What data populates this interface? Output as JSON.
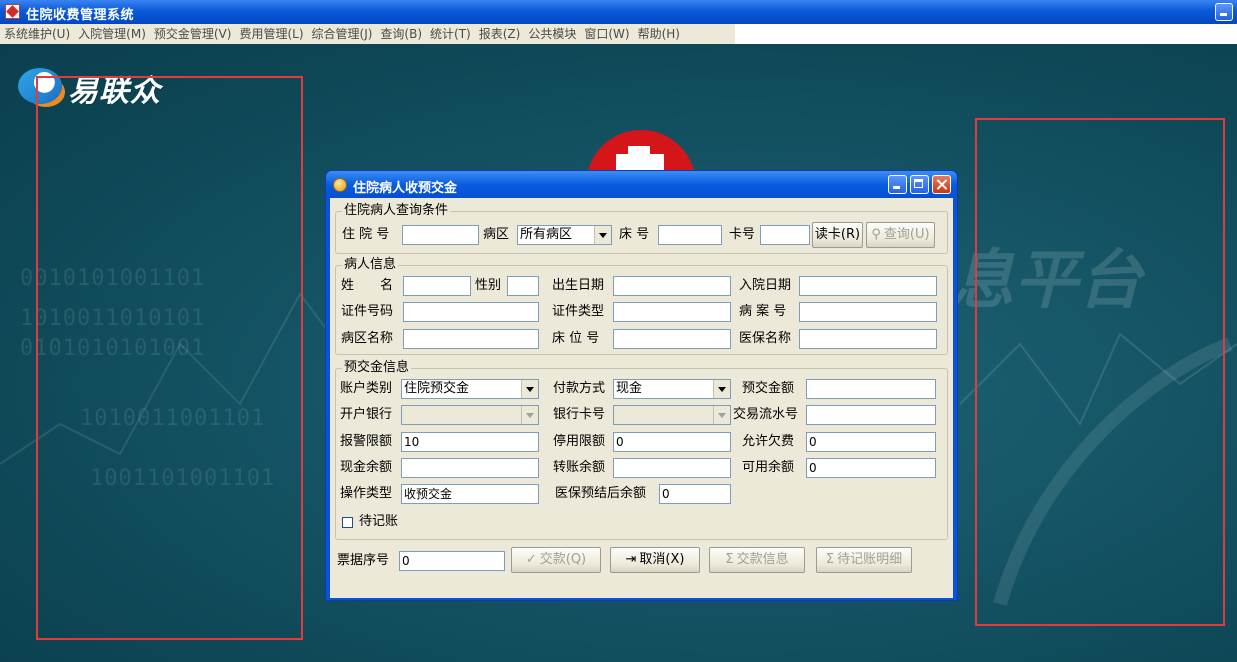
{
  "app": {
    "title": "住院收费管理系统"
  },
  "menu": [
    "系统维护(U)",
    "入院管理(M)",
    "预交金管理(V)",
    "费用管理(L)",
    "综合管理(J)",
    "查询(B)",
    "统计(T)",
    "报表(Z)",
    "公共模块",
    "窗口(W)",
    "帮助(H)"
  ],
  "desktop": {
    "logo_text": "易联众",
    "binary_rows": [
      "0010101001101",
      "1010011010101",
      "0101010101001",
      "1010011001101",
      "1001101001101"
    ],
    "platform_text": "息平台"
  },
  "dialog": {
    "title": "住院病人收预交金",
    "query_group": {
      "legend": "住院病人查询条件",
      "hospital_no_label": "住 院 号",
      "hospital_no_value": "",
      "ward_label": "病区",
      "ward_value": "所有病区",
      "bed_label": "床 号",
      "bed_value": "",
      "card_label": "卡号",
      "card_value": "",
      "read_card_button": "读卡(R)",
      "query_button": "查询(U)"
    },
    "patient_group": {
      "legend": "病人信息",
      "name_label": "姓　　名",
      "name_value": "",
      "gender_label": "性别",
      "gender_value": "",
      "birth_label": "出生日期",
      "birth_value": "",
      "admit_label": "入院日期",
      "admit_value": "",
      "id_no_label": "证件号码",
      "id_no_value": "",
      "id_type_label": "证件类型",
      "id_type_value": "",
      "case_no_label": "病 案 号",
      "case_no_value": "",
      "ward_name_label": "病区名称",
      "ward_name_value": "",
      "bed_no_label": "床 位 号",
      "bed_no_value": "",
      "insurance_label": "医保名称",
      "insurance_value": ""
    },
    "deposit_group": {
      "legend": "预交金信息",
      "account_type_label": "账户类别",
      "account_type_value": "住院预交金",
      "pay_method_label": "付款方式",
      "pay_method_value": "现金",
      "deposit_amount_label": "预交金额",
      "deposit_amount_value": "",
      "bank_label": "开户银行",
      "bank_value": "",
      "bank_card_label": "银行卡号",
      "bank_card_value": "",
      "trade_no_label": "交易流水号",
      "trade_no_value": "",
      "alarm_limit_label": "报警限额",
      "alarm_limit_value": "10",
      "stop_limit_label": "停用限额",
      "stop_limit_value": "0",
      "allow_owe_label": "允许欠费",
      "allow_owe_value": "0",
      "cash_balance_label": "现金余额",
      "cash_balance_value": "",
      "transfer_balance_label": "转账余额",
      "transfer_balance_value": "",
      "available_balance_label": "可用余额",
      "available_balance_value": "0",
      "op_type_label": "操作类型",
      "op_type_value": "收预交金",
      "ins_settle_label": "医保预结后余额",
      "ins_settle_value": "0",
      "pending_label": "待记账"
    },
    "footer": {
      "receipt_no_label": "票据序号",
      "receipt_no_value": "0",
      "pay_button": "交款(Q)",
      "cancel_button": "取消(X)",
      "pay_info_button": "交款信息",
      "pending_detail_button": "待记账明细"
    }
  }
}
